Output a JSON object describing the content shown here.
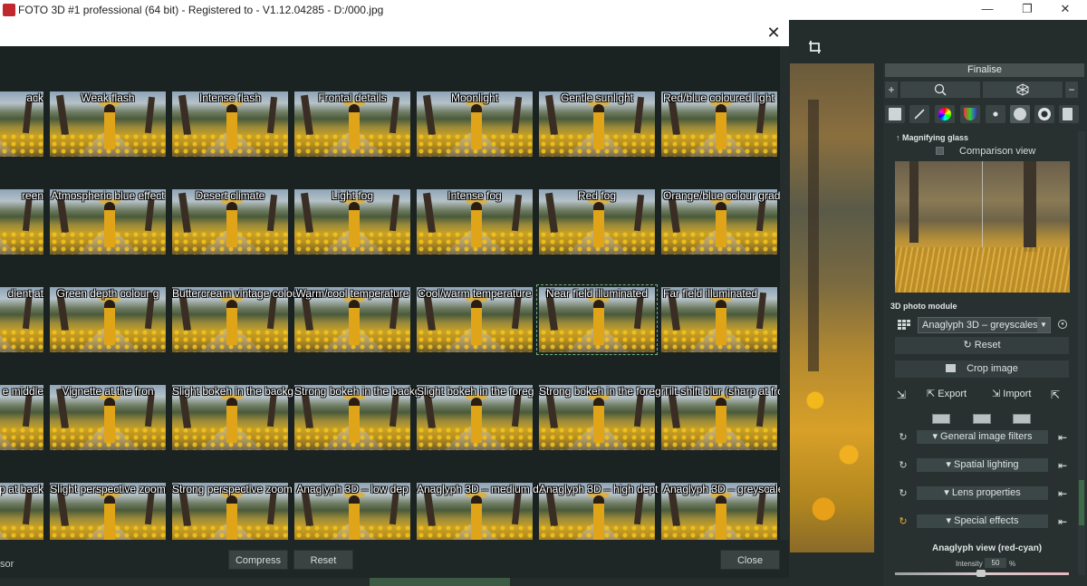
{
  "window": {
    "title": "FOTO 3D #1 professional (64 bit) - Registered to - V1.12.04285 - D:/000.jpg",
    "minimize": "—",
    "restore": "❐",
    "close": "✕"
  },
  "dialog": {
    "close_icon": "✕",
    "thumbnails": [
      [
        "ack",
        "Weak flash",
        "Intense flash",
        "Frontal details",
        "Moonlight",
        "Gentle sunlight",
        "Red/blue coloured light"
      ],
      [
        "reen",
        "Atmospheric blue effect",
        "Desert climate",
        "Light fog",
        "Intense fog",
        "Red fog",
        "Orange/blue colour gradie"
      ],
      [
        "dient at",
        "Green depth colour g",
        "Buttercream vintage colour gra",
        "Warm/cool temperature",
        "Cool/warm temperature",
        "Near field illuminated",
        "Far field illuminated"
      ],
      [
        "e middle",
        "Vignette at the fron",
        "Slight bokeh in the backg",
        "Strong bokeh in the backg",
        "Slight bokeh in the foreg",
        "Strong bokeh in the foregr",
        "Tilt-shift blur (sharp at fron"
      ],
      [
        "rp at back",
        "Slight perspective zoom",
        "Strong perspective zoom",
        "Anaglyph 3D – low dep",
        "Anaglyph 3D – medium de",
        "Anaglyph 3D – high dept",
        "Anaglyph 3D – greyscale"
      ]
    ],
    "selected": {
      "row": 2,
      "col": 5
    },
    "footer": {
      "left_text": "sor",
      "compress": "Compress",
      "reset": "Reset",
      "close": "Close"
    }
  },
  "panel": {
    "finalise": "Finalise",
    "plus": "+",
    "minus": "−",
    "search_icon": "search-icon",
    "magnify_title": "Magnifying glass",
    "comparison_view": "Comparison view",
    "module_title": "3D photo module",
    "module_select": "Anaglyph 3D – greyscales",
    "reset": "Reset",
    "crop": "Crop image",
    "export": "Export",
    "import": "Import",
    "accordions": [
      "General image filters",
      "Spatial lighting",
      "Lens properties",
      "Special effects"
    ],
    "anaglyph_view": "Anaglyph view (red-cyan)",
    "intensity_label": "Intensity",
    "intensity_value": "50",
    "intensity_unit": "%"
  }
}
